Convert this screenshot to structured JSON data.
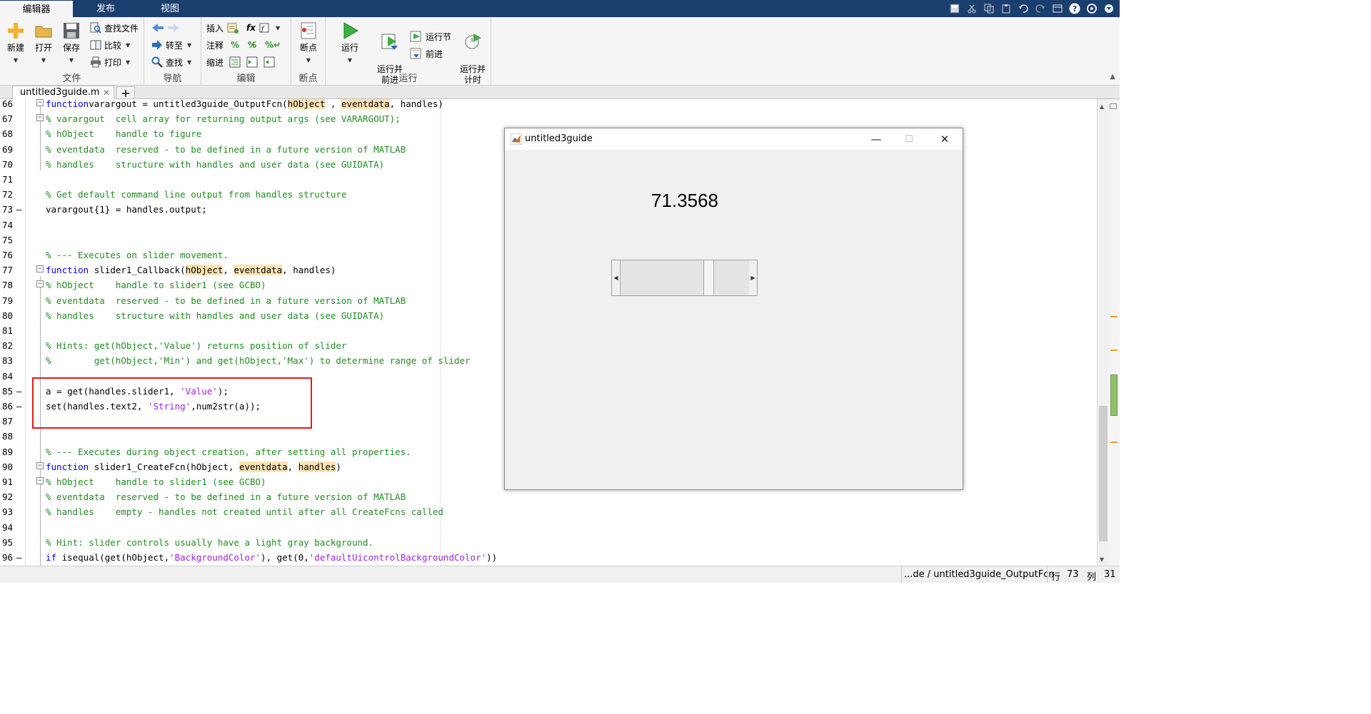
{
  "tabs": [
    "编辑器",
    "发布",
    "视图"
  ],
  "toolstrip": {
    "file": {
      "label": "文件",
      "new": "新建",
      "open": "打开",
      "save": "保存",
      "find_files": "查找文件",
      "compare": "比较",
      "print": "打印"
    },
    "nav": {
      "label": "导航",
      "goto": "转至",
      "find": "查找"
    },
    "edit": {
      "label": "编辑",
      "insert": "插入",
      "comment": "注释",
      "indent": "缩进",
      "fx": "fx"
    },
    "breakpoints": {
      "label": "断点",
      "btn": "断点"
    },
    "run": {
      "label": "运行",
      "run": "运行",
      "run_advance": "运行并\n前进",
      "run_section": "运行节",
      "advance": "前进",
      "run_time": "运行并\n计时"
    }
  },
  "file_tab": {
    "name": "untitled3guide.m",
    "close": "✕",
    "add": "+"
  },
  "editor": {
    "lines": [
      {
        "n": "66",
        "parts": [
          [
            "kw",
            "function"
          ],
          [
            "",
            "varargout = untitled3guide_OutputFcn("
          ],
          [
            "hl",
            "hObject"
          ],
          [
            "",
            " , "
          ],
          [
            "hl",
            "eventdata"
          ],
          [
            "",
            ", handles)"
          ]
        ]
      },
      {
        "n": "67",
        "parts": [
          [
            "cm",
            "% varargout  cell array for returning output args (see VARARGOUT);"
          ]
        ]
      },
      {
        "n": "68",
        "parts": [
          [
            "cm",
            "% hObject    handle to figure"
          ]
        ]
      },
      {
        "n": "69",
        "parts": [
          [
            "cm",
            "% eventdata  reserved - to be defined in a future version of MATLAB"
          ]
        ]
      },
      {
        "n": "70",
        "parts": [
          [
            "cm",
            "% handles    structure with handles and user data (see GUIDATA)"
          ]
        ]
      },
      {
        "n": "71",
        "parts": []
      },
      {
        "n": "72",
        "parts": [
          [
            "cm",
            "% Get default command line output from handles structure"
          ]
        ]
      },
      {
        "n": "73",
        "parts": [
          [
            "",
            "varargout{1} = handles.output;"
          ]
        ]
      },
      {
        "n": "74",
        "parts": []
      },
      {
        "n": "75",
        "parts": []
      },
      {
        "n": "76",
        "parts": [
          [
            "cm",
            "% --- Executes on slider movement."
          ]
        ]
      },
      {
        "n": "77",
        "parts": [
          [
            "kw",
            "function"
          ],
          [
            "",
            " slider1_Callback("
          ],
          [
            "hl",
            "hObject"
          ],
          [
            "",
            ", "
          ],
          [
            "hl",
            "eventdata"
          ],
          [
            "",
            ", handles)"
          ]
        ]
      },
      {
        "n": "78",
        "parts": [
          [
            "cm",
            "% hObject    handle to slider1 (see GCBO)"
          ]
        ]
      },
      {
        "n": "79",
        "parts": [
          [
            "cm",
            "% eventdata  reserved - to be defined in a future version of MATLAB"
          ]
        ]
      },
      {
        "n": "80",
        "parts": [
          [
            "cm",
            "% handles    structure with handles and user data (see GUIDATA)"
          ]
        ]
      },
      {
        "n": "81",
        "parts": []
      },
      {
        "n": "82",
        "parts": [
          [
            "cm",
            "% Hints: get(hObject,'Value') returns position of slider"
          ]
        ]
      },
      {
        "n": "83",
        "parts": [
          [
            "cm",
            "%        get(hObject,'Min') and get(hObject,'Max') to determine range of slider"
          ]
        ]
      },
      {
        "n": "84",
        "parts": []
      },
      {
        "n": "85",
        "parts": [
          [
            "",
            "a = get(handles.slider1, "
          ],
          [
            "st",
            "'Value'"
          ],
          [
            "",
            ");"
          ]
        ]
      },
      {
        "n": "86",
        "parts": [
          [
            "",
            "set(handles.text2, "
          ],
          [
            "st",
            "'String'"
          ],
          [
            "",
            ",num2str(a));"
          ]
        ]
      },
      {
        "n": "87",
        "parts": []
      },
      {
        "n": "88",
        "parts": []
      },
      {
        "n": "89",
        "parts": [
          [
            "cm",
            "% --- Executes during object creation, after setting all properties."
          ]
        ]
      },
      {
        "n": "90",
        "parts": [
          [
            "kw",
            "function"
          ],
          [
            "",
            " slider1_CreateFcn(hObject, "
          ],
          [
            "hl",
            "eventdata"
          ],
          [
            "",
            ", "
          ],
          [
            "hl",
            "handles"
          ],
          [
            "",
            ")"
          ]
        ]
      },
      {
        "n": "91",
        "parts": [
          [
            "cm",
            "% hObject    handle to slider1 (see GCBO)"
          ]
        ]
      },
      {
        "n": "92",
        "parts": [
          [
            "cm",
            "% eventdata  reserved - to be defined in a future version of MATLAB"
          ]
        ]
      },
      {
        "n": "93",
        "parts": [
          [
            "cm",
            "% handles    empty - handles not created until after all CreateFcns called"
          ]
        ]
      },
      {
        "n": "94",
        "parts": []
      },
      {
        "n": "95",
        "parts": [
          [
            "cm",
            "% Hint: slider controls usually have a light gray background."
          ]
        ]
      },
      {
        "n": "96",
        "parts": [
          [
            "kw",
            "if"
          ],
          [
            "",
            " isequal(get(hObject,"
          ],
          [
            "st",
            "'BackgroundColor'"
          ],
          [
            "",
            "), get(0,"
          ],
          [
            "st",
            "'defaultUicontrolBackgroundColor'"
          ],
          [
            "",
            "))"
          ]
        ]
      }
    ]
  },
  "status": {
    "path": "...de / untitled3guide_OutputFcn",
    "row_label": "行",
    "row": "73",
    "col_label": "列",
    "col": "31"
  },
  "figure": {
    "title": "untitled3guide",
    "minimize": "—",
    "maximize": "☐",
    "close": "✕",
    "text_value": "71.3568",
    "slider_level": 0.7136
  }
}
